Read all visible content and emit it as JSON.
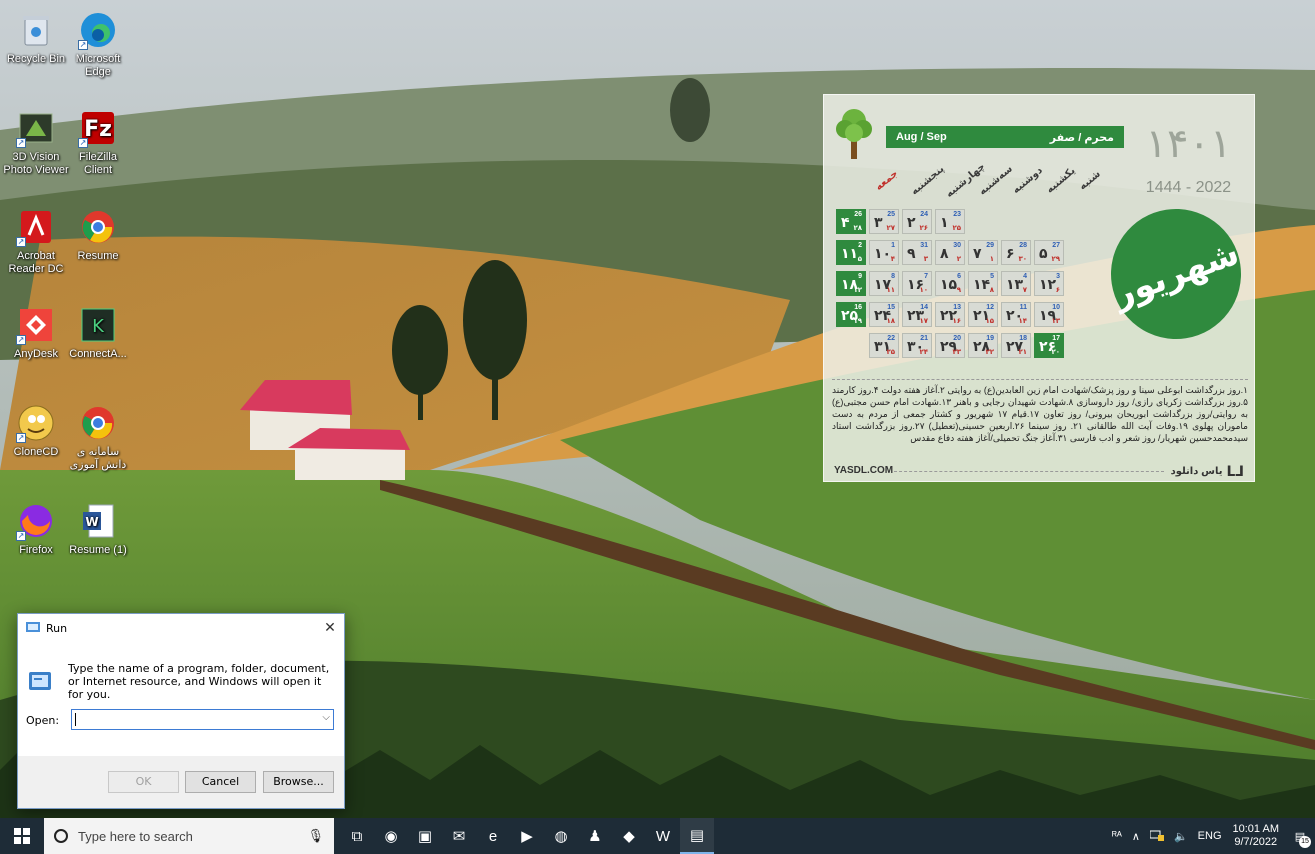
{
  "desktop": {
    "icons": [
      {
        "label": "Recycle Bin",
        "icon": "recycle-bin-icon"
      },
      {
        "label": "Microsoft Edge",
        "icon": "edge-icon"
      },
      {
        "label": "3D Vision Photo Viewer",
        "icon": "3d-vision-icon"
      },
      {
        "label": "FileZilla Client",
        "icon": "filezilla-icon"
      },
      {
        "label": "Acrobat Reader DC",
        "icon": "acrobat-icon"
      },
      {
        "label": "Resume",
        "icon": "chrome-icon"
      },
      {
        "label": "AnyDesk",
        "icon": "anydesk-icon"
      },
      {
        "label": "ConnectA...",
        "icon": "connect-icon"
      },
      {
        "label": "CloneCD",
        "icon": "clonecd-icon"
      },
      {
        "label": "سامانه ی دانش آموزی",
        "icon": "chrome-icon"
      },
      {
        "label": "Firefox",
        "icon": "firefox-icon"
      },
      {
        "label": "Resume (1)",
        "icon": "word-icon"
      }
    ]
  },
  "calendar": {
    "header_left": "Aug / Sep",
    "header_right": "محرم / صفر",
    "year_big": "۱۴۰۱",
    "year_small": "1444 - 2022",
    "month_name": "شهریور",
    "weekdays": [
      "شنبه",
      "یکشنبه",
      "دوشنبه",
      "سه‌شنبه",
      "چهارشنبه",
      "پنجشنبه",
      "جمعه"
    ],
    "rows": [
      [
        {
          "p": "۴",
          "g": "26",
          "h": "۲۸",
          "green": true
        },
        {
          "p": "۳",
          "g": "25",
          "h": "۲۷",
          "green": false
        },
        {
          "p": "۲",
          "g": "24",
          "h": "۲۶",
          "green": false
        },
        {
          "p": "۱",
          "g": "23",
          "h": "۲۵",
          "green": false
        }
      ],
      [
        {
          "p": "۱۱",
          "g": "2",
          "h": "۵",
          "green": true
        },
        {
          "p": "۱۰",
          "g": "1",
          "h": "۴",
          "green": false
        },
        {
          "p": "۹",
          "g": "31",
          "h": "۳",
          "green": false
        },
        {
          "p": "۸",
          "g": "30",
          "h": "۲",
          "green": false
        },
        {
          "p": "۷",
          "g": "29",
          "h": "۱",
          "green": false
        },
        {
          "p": "۶",
          "g": "28",
          "h": "۳۰",
          "green": false
        },
        {
          "p": "۵",
          "g": "27",
          "h": "۲۹",
          "green": false
        }
      ],
      [
        {
          "p": "۱۸",
          "g": "9",
          "h": "۱۲",
          "green": true
        },
        {
          "p": "۱۷",
          "g": "8",
          "h": "۱۱",
          "green": false
        },
        {
          "p": "۱۶",
          "g": "7",
          "h": "۱۰",
          "green": false
        },
        {
          "p": "۱۵",
          "g": "6",
          "h": "۹",
          "green": false
        },
        {
          "p": "۱۴",
          "g": "5",
          "h": "۸",
          "green": false
        },
        {
          "p": "۱۳",
          "g": "4",
          "h": "۷",
          "green": false
        },
        {
          "p": "۱۲",
          "g": "3",
          "h": "۶",
          "green": false
        }
      ],
      [
        {
          "p": "۲۵",
          "g": "16",
          "h": "۱۹",
          "green": true
        },
        {
          "p": "۲۴",
          "g": "15",
          "h": "۱۸",
          "green": false
        },
        {
          "p": "۲۳",
          "g": "14",
          "h": "۱۷",
          "green": false
        },
        {
          "p": "۲۲",
          "g": "13",
          "h": "۱۶",
          "green": false
        },
        {
          "p": "۲۱",
          "g": "12",
          "h": "۱۵",
          "green": false
        },
        {
          "p": "۲۰",
          "g": "11",
          "h": "۱۴",
          "green": false
        },
        {
          "p": "۱۹",
          "g": "10",
          "h": "۱۳",
          "green": false
        }
      ],
      [
        {
          "p": "۳۱",
          "g": "22",
          "h": "۲۵",
          "green": false
        },
        {
          "p": "۳۰",
          "g": "21",
          "h": "۲۴",
          "green": false
        },
        {
          "p": "۲۹",
          "g": "20",
          "h": "۲۳",
          "green": false
        },
        {
          "p": "۲۸",
          "g": "19",
          "h": "۲۲",
          "green": false
        },
        {
          "p": "۲۷",
          "g": "18",
          "h": "۲۱",
          "green": false
        },
        {
          "p": "۲۶",
          "g": "17",
          "h": "۲۰",
          "green": true
        }
      ]
    ],
    "events": "۱.روز بزرگداشت ابوعلی سینا و روز پزشک/شهادت امام زین العابدین(ع) به روایتی ۲.آغاز هفته دولت ۴.روز کارمند ۵.روز بزرگداشت زکریای رازی/ روز داروسازی ۸.شهادت شهیدان رجایی و باهنر ۱۳.شهادت امام حسن مجتبی(ع) به روایتی/روز بزرگداشت ابوریحان بیرونی/ روز تعاون ۱۷.قیام ۱۷ شهریور و کشتار جمعی از مردم به دست ماموران پهلوی ۱۹.وفات آیت الله طالقانی ۲۱. روز سینما ۲۶.اربعین حسینی(تعطیل) ۲۷.روز بزرگداشت استاد سیدمحمدحسین شهریار/ روز شعر و ادب فارسی ۳۱.آغاز جنگ تحمیلی/آغاز هفته دفاع مقدس",
    "footer_left": "YASDL.COM",
    "footer_right": "یاس دانلود"
  },
  "run_dialog": {
    "title": "Run",
    "description": "Type the name of a program, folder, document, or Internet resource, and Windows will open it for you.",
    "open_label": "Open:",
    "open_value": "",
    "ok_label": "OK",
    "cancel_label": "Cancel",
    "browse_label": "Browse...",
    "close_glyph": "✕"
  },
  "taskbar": {
    "search_placeholder": "Type here to search",
    "apps": [
      {
        "icon": "task-view-icon",
        "glyph": "⧉"
      },
      {
        "icon": "edge-icon",
        "glyph": "◉"
      },
      {
        "icon": "store-icon",
        "glyph": "▣"
      },
      {
        "icon": "mail-icon",
        "glyph": "✉"
      },
      {
        "icon": "ie-icon",
        "glyph": "e"
      },
      {
        "icon": "media-player-icon",
        "glyph": "▶"
      },
      {
        "icon": "chrome-icon",
        "glyph": "◍"
      },
      {
        "icon": "people-icon",
        "glyph": "♟"
      },
      {
        "icon": "anydesk-icon",
        "glyph": "◆"
      },
      {
        "icon": "word-icon",
        "glyph": "W"
      },
      {
        "icon": "run-icon",
        "glyph": "▤"
      }
    ],
    "tray": {
      "people_glyph": "ᴿᴬ",
      "chevron_glyph": "∧",
      "volume_glyph": "🔈",
      "language": "ENG",
      "time": "10:01 AM",
      "date": "9/7/2022",
      "notification_count": "15"
    }
  }
}
